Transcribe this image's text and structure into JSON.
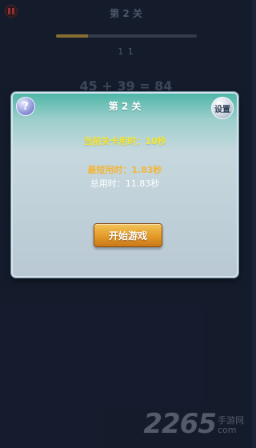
{
  "background": {
    "level_title": "第 2 关",
    "progress": 0.23,
    "counter": "1 1",
    "equation": "45 + 39 = 84"
  },
  "dialog": {
    "title": "第 2 关",
    "help_label": "?",
    "settings_label": "设置",
    "current_time": "当前关卡用时：10秒",
    "best_time": "最短用时：1.83秒",
    "total_time": "总用时：11.83秒",
    "start_label": "开始游戏"
  },
  "watermark": {
    "number": "2265",
    "text_line1": "手游网",
    "text_line2": "com"
  },
  "colors": {
    "background": "#1b2438",
    "accent_yellow": "#f5e72e",
    "accent_orange": "#f2b637",
    "button_orange": "#e39a27"
  },
  "icons": [
    "pause-icon",
    "question-icon"
  ]
}
